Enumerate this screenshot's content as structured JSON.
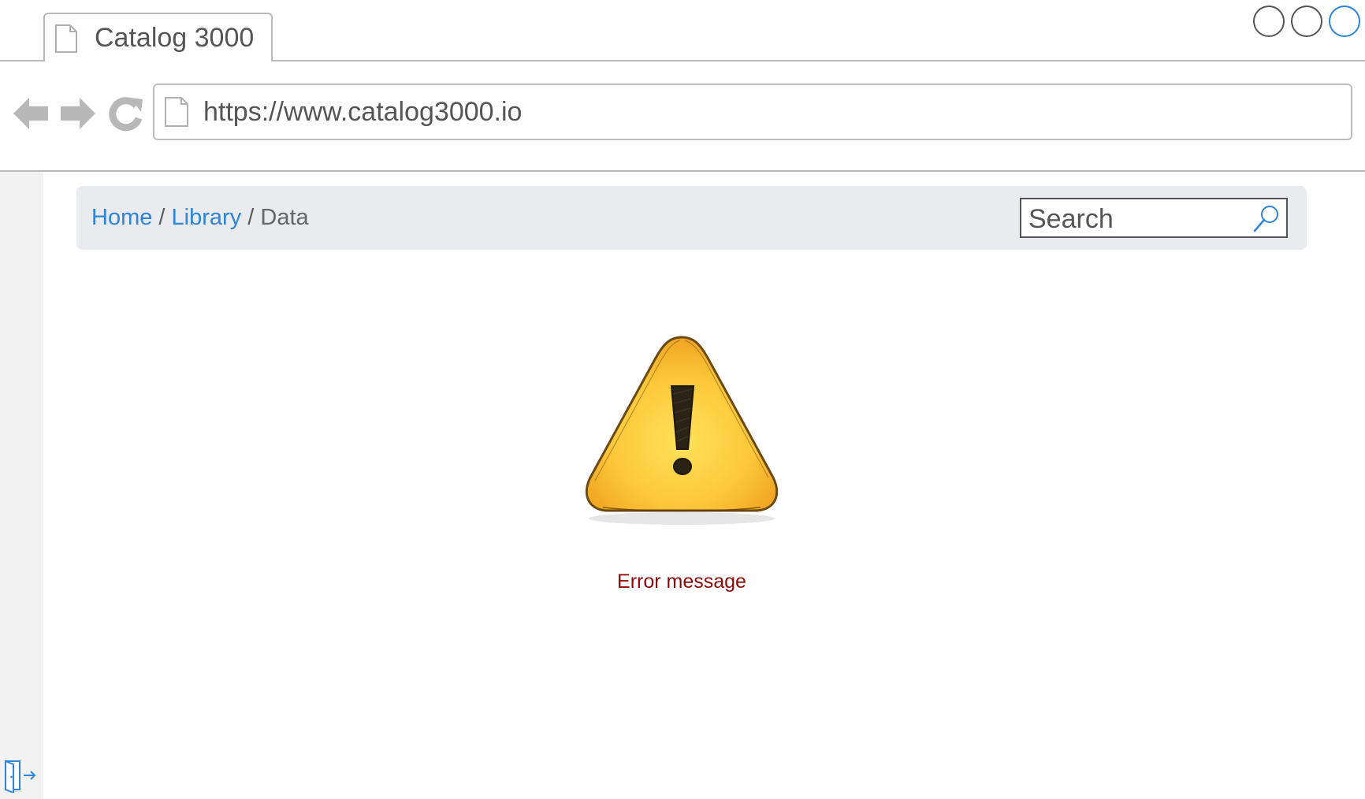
{
  "browser": {
    "tab_title": "Catalog 3000",
    "url": "https://www.catalog3000.io",
    "window_controls": [
      "circle",
      "circle",
      "circle"
    ]
  },
  "breadcrumb": {
    "items": [
      "Home",
      "Library",
      "Data"
    ],
    "separator": "/"
  },
  "search": {
    "placeholder": "Search"
  },
  "main": {
    "error_message": "Error message",
    "warning_icon": "warning-triangle-icon"
  },
  "colors": {
    "link": "#2d84d8",
    "error": "#8b0a0a",
    "header_bg": "#eaebee",
    "accent_circle": "#2d84d8"
  }
}
